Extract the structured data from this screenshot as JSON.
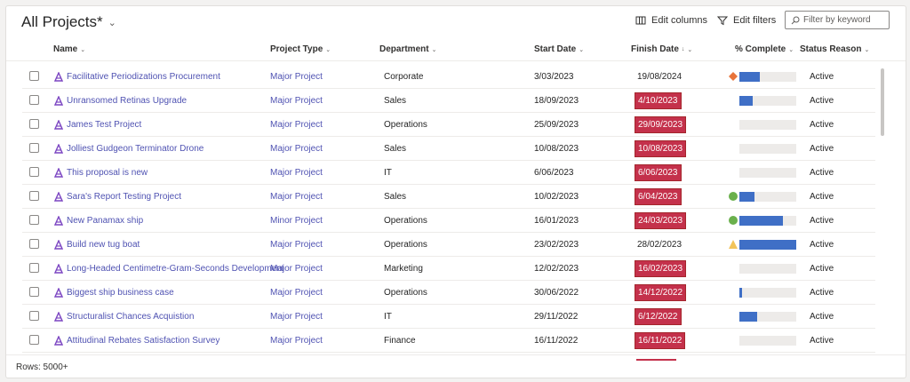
{
  "view": {
    "title": "All Projects*"
  },
  "toolbar": {
    "edit_columns": "Edit columns",
    "edit_filters": "Edit filters"
  },
  "search": {
    "placeholder": "Filter by keyword"
  },
  "columns": {
    "name": "Name",
    "project_type": "Project Type",
    "department": "Department",
    "start_date": "Start Date",
    "finish_date": "Finish Date",
    "percent_complete": "% Complete",
    "status_reason": "Status Reason"
  },
  "colors": {
    "link": "#4f52b2",
    "overdue": "#c4314b",
    "progress": "#3f6fc6",
    "green": "#6ab04c",
    "diamond": "#e8743b",
    "warning": "#f2c45a"
  },
  "rows": [
    {
      "name": "Facilitative Periodizations Procurement",
      "type": "Major Project",
      "department": "Corporate",
      "start": "3/03/2023",
      "finish": "19/08/2024",
      "overdue": false,
      "progress": 0.36,
      "indicator": "diamond-icon",
      "status": "Active"
    },
    {
      "name": "Unransomed Retinas Upgrade",
      "type": "Major Project",
      "department": "Sales",
      "start": "18/09/2023",
      "finish": "4/10/2023",
      "overdue": true,
      "progress": 0.24,
      "indicator": "",
      "status": "Active"
    },
    {
      "name": "James Test Project",
      "type": "Major Project",
      "department": "Operations",
      "start": "25/09/2023",
      "finish": "29/09/2023",
      "overdue": true,
      "progress": 0.0,
      "indicator": "",
      "status": "Active"
    },
    {
      "name": "Jolliest Gudgeon Terminator Drone",
      "type": "Major Project",
      "department": "Sales",
      "start": "10/08/2023",
      "finish": "10/08/2023",
      "overdue": true,
      "progress": 0.0,
      "indicator": "",
      "status": "Active"
    },
    {
      "name": "This proposal is new",
      "type": "Major Project",
      "department": "IT",
      "start": "6/06/2023",
      "finish": "6/06/2023",
      "overdue": true,
      "progress": 0.0,
      "indicator": "",
      "status": "Active"
    },
    {
      "name": "Sara's Report Testing Project",
      "type": "Major Project",
      "department": "Sales",
      "start": "10/02/2023",
      "finish": "6/04/2023",
      "overdue": true,
      "progress": 0.27,
      "indicator": "green-circle-icon",
      "status": "Active"
    },
    {
      "name": "New Panamax ship",
      "type": "Minor Project",
      "department": "Operations",
      "start": "16/01/2023",
      "finish": "24/03/2023",
      "overdue": true,
      "progress": 0.77,
      "indicator": "green-circle-icon",
      "status": "Active"
    },
    {
      "name": "Build new tug boat",
      "type": "Major Project",
      "department": "Operations",
      "start": "23/02/2023",
      "finish": "28/02/2023",
      "overdue": false,
      "progress": 1.0,
      "indicator": "warning-triangle-icon",
      "status": "Active"
    },
    {
      "name": "Long-Headed Centimetre-Gram-Seconds Development",
      "type": "Major Project",
      "department": "Marketing",
      "start": "12/02/2023",
      "finish": "16/02/2023",
      "overdue": true,
      "progress": 0.0,
      "indicator": "",
      "status": "Active"
    },
    {
      "name": "Biggest ship business case",
      "type": "Major Project",
      "department": "Operations",
      "start": "30/06/2022",
      "finish": "14/12/2022",
      "overdue": true,
      "progress": 0.05,
      "indicator": "",
      "status": "Active"
    },
    {
      "name": "Structuralist Chances Acquistion",
      "type": "Major Project",
      "department": "IT",
      "start": "29/11/2022",
      "finish": "6/12/2022",
      "overdue": true,
      "progress": 0.32,
      "indicator": "",
      "status": "Active"
    },
    {
      "name": "Attitudinal Rebates Satisfaction Survey",
      "type": "Major Project",
      "department": "Finance",
      "start": "16/11/2022",
      "finish": "16/11/2022",
      "overdue": true,
      "progress": 0.0,
      "indicator": "",
      "status": "Active"
    }
  ],
  "footer": {
    "rows_label": "Rows: 5000+"
  }
}
